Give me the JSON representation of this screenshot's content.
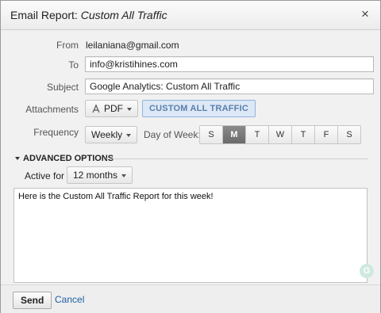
{
  "dialog": {
    "title_prefix": "Email Report:",
    "title_report": "Custom All Traffic",
    "close_glyph": "×"
  },
  "from": {
    "label": "From",
    "value": "leilaniana@gmail.com"
  },
  "to": {
    "label": "To",
    "value": "info@kristihines.com"
  },
  "subject": {
    "label": "Subject",
    "value": "Google Analytics: Custom All Traffic"
  },
  "attachments": {
    "label": "Attachments",
    "format": "PDF",
    "format_icon": "pdf-icon",
    "report_tag": "CUSTOM ALL TRAFFIC"
  },
  "frequency": {
    "label": "Frequency",
    "value": "Weekly",
    "day_of_week_label": "Day of Week:",
    "days": [
      "S",
      "M",
      "T",
      "W",
      "T",
      "F",
      "S"
    ],
    "selected_day_index": 1
  },
  "advanced": {
    "label": "ADVANCED OPTIONS",
    "active_for_label": "Active for",
    "active_for_value": "12 months"
  },
  "message": {
    "body": "Here is the Custom All Traffic Report for this week!"
  },
  "footer": {
    "send_label": "Send",
    "cancel_label": "Cancel"
  },
  "colors": {
    "link": "#1f5ea8",
    "tag_bg": "#dde8f6",
    "tag_text": "#5a7fad",
    "selected_day": "#6a6a6a"
  }
}
